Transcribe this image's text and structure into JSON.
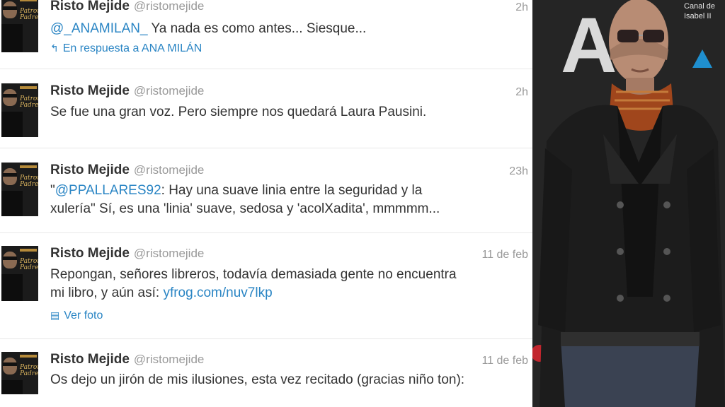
{
  "tweets": [
    {
      "name": "Risto Mejide",
      "handle": "@ristomejide",
      "time": "2h",
      "mention": "@_ANAMILAN_",
      "text": " Ya nada es como antes... Siesque...",
      "reply_label": "En respuesta a ANA MILÁN"
    },
    {
      "name": "Risto Mejide",
      "handle": "@ristomejide",
      "time": "2h",
      "text": "Se fue una gran voz. Pero siempre nos quedará Laura Pausini."
    },
    {
      "name": "Risto Mejide",
      "handle": "@ristomejide",
      "time": "23h",
      "quote_open": "\"",
      "mention": "@PPALLARES92",
      "line1_rest": ": Hay una suave linia entre la seguridad y la",
      "line2": "xulería\" Sí, es una 'linia' suave, sedosa y 'acolXadita', mmmmm..."
    },
    {
      "name": "Risto Mejide",
      "handle": "@ristomejide",
      "time": "11 de feb",
      "line1": "Repongan, señores libreros, todavía demasiada gente no encuentra",
      "line2": "mi libro, y aún así: ",
      "link": "yfrog.com/nuv7lkp",
      "photo_label": "Ver foto"
    },
    {
      "name": "Risto Mejide",
      "handle": "@ristomejide",
      "time": "11 de feb",
      "text": "Os dejo un jirón de mis ilusiones, esta vez recitado (gracias niño ton):"
    }
  ],
  "avatar_poster_text": "Patrono Padre",
  "photo_backdrop": {
    "logo_letter": "A",
    "sponsor_line1": "Canal de",
    "sponsor_line2": "Isabel II"
  },
  "icons": {
    "reply": "reply-arrow-icon",
    "photo": "photo-icon"
  },
  "colors": {
    "link": "#2a85c4",
    "name": "#333333",
    "muted": "#999999",
    "divider": "#e8e8e8"
  }
}
